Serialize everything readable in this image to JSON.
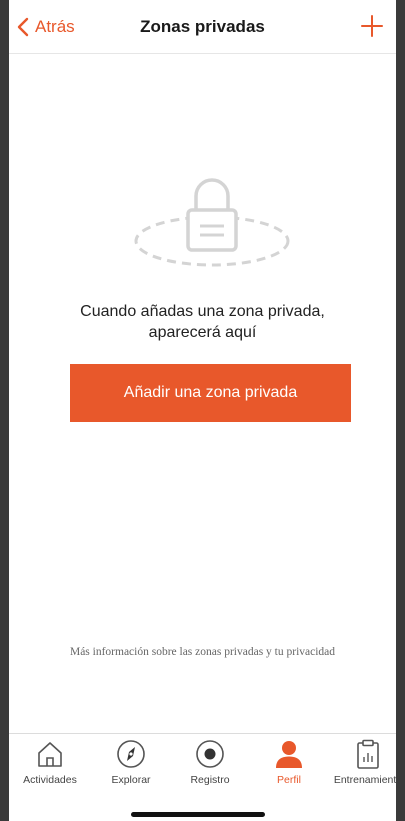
{
  "navbar": {
    "back_label": "Atrás",
    "title": "Zonas privadas",
    "add_icon": "plus-icon"
  },
  "empty_state": {
    "illustration_icon": "lock-icon",
    "message_line1": "Cuando añadas una zona privada,",
    "message_line2": "aparecerá aquí",
    "button_label": "Añadir una zona privada"
  },
  "info_link": "Más información sobre las zonas privadas y tu privacidad",
  "tabbar": {
    "active": "Perfil",
    "items": [
      {
        "label": "Actividades",
        "icon": "home-icon"
      },
      {
        "label": "Explorar",
        "icon": "compass-icon"
      },
      {
        "label": "Registro",
        "icon": "record-icon"
      },
      {
        "label": "Perfil",
        "icon": "person-icon"
      },
      {
        "label": "Entrenamiento",
        "icon": "clipboard-chart-icon"
      }
    ]
  },
  "colors": {
    "accent": "#e8582b",
    "text": "#222222",
    "muted": "#666666"
  }
}
